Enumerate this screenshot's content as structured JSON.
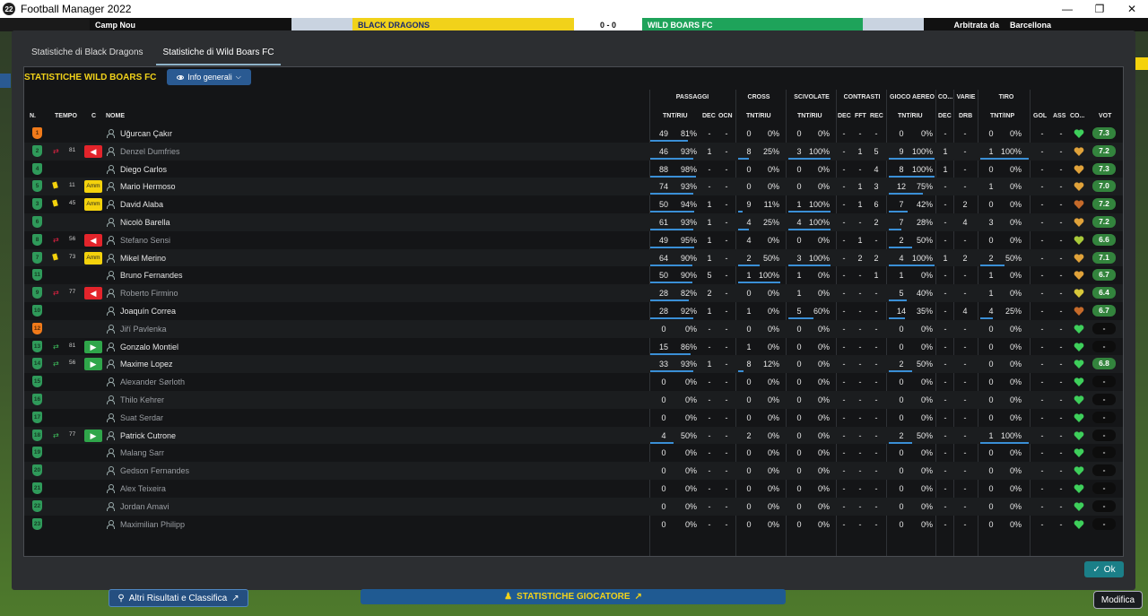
{
  "window": {
    "title": "Football Manager 2022",
    "app_icon": "22",
    "minimize": "—",
    "restore": "❐",
    "close": "✕"
  },
  "strip": {
    "stadium": "Camp Nou",
    "home_banner": "BLACK DRAGONS",
    "score": "0 - 0",
    "away_banner": "WILD BOARS FC",
    "referee_label": "Arbitrata da",
    "city": "Barcellona"
  },
  "tabs": [
    {
      "label": "Statistiche di Black Dragons",
      "active": false
    },
    {
      "label": "Statistiche di Wild Boars FC",
      "active": true
    }
  ],
  "panel": {
    "title": "STATISTICHE WILD BOARS FC",
    "filter_label": "Info generali",
    "filter_icon": "eye-icon",
    "chevron_icon": "chevron-down-icon"
  },
  "groups": {
    "passaggi": "PASSAGGI",
    "cross": "CROSS",
    "scivolate": "SCIVOLATE",
    "contrasti": "CONTRASTI",
    "gioco_aereo": "GIOCO AEREO",
    "co": "CO...",
    "varie": "VARIE",
    "tiro": "TIRO"
  },
  "columns": {
    "n": "N.",
    "tempo": "TEMPO",
    "c": "C",
    "nome": "NOME",
    "pass_tnt": "TNT/RIU",
    "pass_dec": "DEC",
    "pass_ocn": "OCN",
    "cross_tnt": "TNT/RIU",
    "sciv_tnt": "TNT/RIU",
    "con_dec": "DEC",
    "con_fft": "FFT",
    "con_rec": "REC",
    "aereo_tnt": "TNT/RIU",
    "co_dec": "DEC",
    "varie_drb": "DRB",
    "tiro_tnt": "TNT/INP",
    "gol": "GOL",
    "ass": "ASS",
    "co": "CO...",
    "vot": "VOT"
  },
  "colors": {
    "accent_yellow": "#f1d21a",
    "bar_blue": "#3a8fd6",
    "rating_green": "#33843d",
    "yellow_card": "#f4d20c",
    "sub_out": "#e3242b",
    "sub_in": "#2fa64a"
  },
  "players": [
    {
      "n": "1",
      "gk": true,
      "card": "",
      "sub": "",
      "min": "",
      "c": "",
      "name": "Uğurcan Çakır",
      "dim": false,
      "pass_t": "49",
      "pass_p": "81%",
      "pass_f": 0.81,
      "dec": "-",
      "ocn": "-",
      "cross_t": "0",
      "cross_p": "0%",
      "cross_f": 0,
      "sciv_t": "0",
      "sciv_p": "0%",
      "sciv_f": 0,
      "cdec": "-",
      "cfft": "-",
      "crec": "-",
      "aer_t": "0",
      "aer_p": "0%",
      "aer_f": 0,
      "codec": "-",
      "drb": "-",
      "tiro_t": "0",
      "tiro_p": "0%",
      "tiro_f": 0,
      "gol": "-",
      "ass": "-",
      "heart": "#3ecf5b",
      "vot": "7.3"
    },
    {
      "n": "2",
      "gk": false,
      "card": "",
      "sub": "out",
      "min": "81",
      "c": "out",
      "name": "Denzel Dumfries",
      "dim": true,
      "pass_t": "46",
      "pass_p": "93%",
      "pass_f": 0.93,
      "dec": "1",
      "ocn": "-",
      "cross_t": "8",
      "cross_p": "25%",
      "cross_f": 0.25,
      "sciv_t": "3",
      "sciv_p": "100%",
      "sciv_f": 1,
      "cdec": "-",
      "cfft": "1",
      "crec": "5",
      "aer_t": "9",
      "aer_p": "100%",
      "aer_f": 1,
      "codec": "1",
      "drb": "-",
      "tiro_t": "1",
      "tiro_p": "100%",
      "tiro_f": 1,
      "gol": "-",
      "ass": "-",
      "heart": "#e0a23a",
      "vot": "7.2"
    },
    {
      "n": "4",
      "gk": false,
      "card": "",
      "sub": "",
      "min": "",
      "c": "",
      "name": "Diego Carlos",
      "dim": false,
      "pass_t": "88",
      "pass_p": "98%",
      "pass_f": 0.98,
      "dec": "-",
      "ocn": "-",
      "cross_t": "0",
      "cross_p": "0%",
      "cross_f": 0,
      "sciv_t": "0",
      "sciv_p": "0%",
      "sciv_f": 0,
      "cdec": "-",
      "cfft": "-",
      "crec": "4",
      "aer_t": "8",
      "aer_p": "100%",
      "aer_f": 1,
      "codec": "1",
      "drb": "-",
      "tiro_t": "0",
      "tiro_p": "0%",
      "tiro_f": 0,
      "gol": "-",
      "ass": "-",
      "heart": "#e0a23a",
      "vot": "7.3"
    },
    {
      "n": "5",
      "gk": false,
      "card": "y",
      "sub": "",
      "min": "11",
      "c": "amm",
      "name": "Mario Hermoso",
      "dim": false,
      "pass_t": "74",
      "pass_p": "93%",
      "pass_f": 0.93,
      "dec": "-",
      "ocn": "-",
      "cross_t": "0",
      "cross_p": "0%",
      "cross_f": 0,
      "sciv_t": "0",
      "sciv_p": "0%",
      "sciv_f": 0,
      "cdec": "-",
      "cfft": "1",
      "crec": "3",
      "aer_t": "12",
      "aer_p": "75%",
      "aer_f": 0.75,
      "codec": "-",
      "drb": "-",
      "tiro_t": "1",
      "tiro_p": "0%",
      "tiro_f": 0,
      "gol": "-",
      "ass": "-",
      "heart": "#e0a23a",
      "vot": "7.0"
    },
    {
      "n": "3",
      "gk": false,
      "card": "y",
      "sub": "",
      "min": "45",
      "c": "amm",
      "name": "David Alaba",
      "dim": false,
      "pass_t": "50",
      "pass_p": "94%",
      "pass_f": 0.94,
      "dec": "1",
      "ocn": "-",
      "cross_t": "9",
      "cross_p": "11%",
      "cross_f": 0.11,
      "sciv_t": "1",
      "sciv_p": "100%",
      "sciv_f": 1,
      "cdec": "-",
      "cfft": "1",
      "crec": "6",
      "aer_t": "7",
      "aer_p": "42%",
      "aer_f": 0.42,
      "codec": "-",
      "drb": "2",
      "tiro_t": "0",
      "tiro_p": "0%",
      "tiro_f": 0,
      "gol": "-",
      "ass": "-",
      "heart": "#c56a2a",
      "vot": "7.2"
    },
    {
      "n": "6",
      "gk": false,
      "card": "",
      "sub": "",
      "min": "",
      "c": "",
      "name": "Nicolò Barella",
      "dim": false,
      "pass_t": "61",
      "pass_p": "93%",
      "pass_f": 0.93,
      "dec": "1",
      "ocn": "-",
      "cross_t": "4",
      "cross_p": "25%",
      "cross_f": 0.25,
      "sciv_t": "4",
      "sciv_p": "100%",
      "sciv_f": 1,
      "cdec": "-",
      "cfft": "-",
      "crec": "2",
      "aer_t": "7",
      "aer_p": "28%",
      "aer_f": 0.28,
      "codec": "-",
      "drb": "4",
      "tiro_t": "3",
      "tiro_p": "0%",
      "tiro_f": 0,
      "gol": "-",
      "ass": "-",
      "heart": "#e0a23a",
      "vot": "7.2"
    },
    {
      "n": "8",
      "gk": false,
      "card": "",
      "sub": "out",
      "min": "56",
      "c": "out",
      "name": "Stefano Sensi",
      "dim": true,
      "pass_t": "49",
      "pass_p": "95%",
      "pass_f": 0.95,
      "dec": "1",
      "ocn": "-",
      "cross_t": "4",
      "cross_p": "0%",
      "cross_f": 0,
      "sciv_t": "0",
      "sciv_p": "0%",
      "sciv_f": 0,
      "cdec": "-",
      "cfft": "1",
      "crec": "-",
      "aer_t": "2",
      "aer_p": "50%",
      "aer_f": 0.5,
      "codec": "-",
      "drb": "-",
      "tiro_t": "0",
      "tiro_p": "0%",
      "tiro_f": 0,
      "gol": "-",
      "ass": "-",
      "heart": "#a8c93a",
      "vot": "6.6"
    },
    {
      "n": "7",
      "gk": false,
      "card": "y",
      "sub": "",
      "min": "73",
      "c": "amm",
      "name": "Mikel Merino",
      "dim": false,
      "pass_t": "64",
      "pass_p": "90%",
      "pass_f": 0.9,
      "dec": "1",
      "ocn": "-",
      "cross_t": "2",
      "cross_p": "50%",
      "cross_f": 0.5,
      "sciv_t": "3",
      "sciv_p": "100%",
      "sciv_f": 1,
      "cdec": "-",
      "cfft": "2",
      "crec": "2",
      "aer_t": "4",
      "aer_p": "100%",
      "aer_f": 1,
      "codec": "1",
      "drb": "2",
      "tiro_t": "2",
      "tiro_p": "50%",
      "tiro_f": 0.5,
      "gol": "-",
      "ass": "-",
      "heart": "#e0a23a",
      "vot": "7.1"
    },
    {
      "n": "11",
      "gk": false,
      "card": "",
      "sub": "",
      "min": "",
      "c": "",
      "name": "Bruno Fernandes",
      "dim": false,
      "pass_t": "50",
      "pass_p": "90%",
      "pass_f": 0.9,
      "dec": "5",
      "ocn": "-",
      "cross_t": "1",
      "cross_p": "100%",
      "cross_f": 1,
      "sciv_t": "1",
      "sciv_p": "0%",
      "sciv_f": 0,
      "cdec": "-",
      "cfft": "-",
      "crec": "1",
      "aer_t": "1",
      "aer_p": "0%",
      "aer_f": 0,
      "codec": "-",
      "drb": "-",
      "tiro_t": "1",
      "tiro_p": "0%",
      "tiro_f": 0,
      "gol": "-",
      "ass": "-",
      "heart": "#e0a23a",
      "vot": "6.7"
    },
    {
      "n": "9",
      "gk": false,
      "card": "",
      "sub": "out",
      "min": "77",
      "c": "out",
      "name": "Roberto Firmino",
      "dim": true,
      "pass_t": "28",
      "pass_p": "82%",
      "pass_f": 0.82,
      "dec": "2",
      "ocn": "-",
      "cross_t": "0",
      "cross_p": "0%",
      "cross_f": 0,
      "sciv_t": "1",
      "sciv_p": "0%",
      "sciv_f": 0,
      "cdec": "-",
      "cfft": "-",
      "crec": "-",
      "aer_t": "5",
      "aer_p": "40%",
      "aer_f": 0.4,
      "codec": "-",
      "drb": "-",
      "tiro_t": "1",
      "tiro_p": "0%",
      "tiro_f": 0,
      "gol": "-",
      "ass": "-",
      "heart": "#d8c83a",
      "vot": "6.4"
    },
    {
      "n": "10",
      "gk": false,
      "card": "",
      "sub": "",
      "min": "",
      "c": "",
      "name": "Joaquín Correa",
      "dim": false,
      "pass_t": "28",
      "pass_p": "92%",
      "pass_f": 0.92,
      "dec": "1",
      "ocn": "-",
      "cross_t": "1",
      "cross_p": "0%",
      "cross_f": 0,
      "sciv_t": "5",
      "sciv_p": "60%",
      "sciv_f": 0.6,
      "cdec": "-",
      "cfft": "-",
      "crec": "-",
      "aer_t": "14",
      "aer_p": "35%",
      "aer_f": 0.35,
      "codec": "-",
      "drb": "4",
      "tiro_t": "4",
      "tiro_p": "25%",
      "tiro_f": 0.25,
      "gol": "-",
      "ass": "-",
      "heart": "#c56a2a",
      "vot": "6.7"
    },
    {
      "n": "12",
      "gk": true,
      "card": "",
      "sub": "",
      "min": "",
      "c": "",
      "name": "Jiří Pavlenka",
      "dim": true,
      "pass_t": "0",
      "pass_p": "0%",
      "pass_f": 0,
      "dec": "-",
      "ocn": "-",
      "cross_t": "0",
      "cross_p": "0%",
      "cross_f": 0,
      "sciv_t": "0",
      "sciv_p": "0%",
      "sciv_f": 0,
      "cdec": "-",
      "cfft": "-",
      "crec": "-",
      "aer_t": "0",
      "aer_p": "0%",
      "aer_f": 0,
      "codec": "-",
      "drb": "-",
      "tiro_t": "0",
      "tiro_p": "0%",
      "tiro_f": 0,
      "gol": "-",
      "ass": "-",
      "heart": "#3ecf5b",
      "vot": "-"
    },
    {
      "n": "13",
      "gk": false,
      "card": "",
      "sub": "in",
      "min": "81",
      "c": "in",
      "name": "Gonzalo Montiel",
      "dim": false,
      "pass_t": "15",
      "pass_p": "86%",
      "pass_f": 0.86,
      "dec": "-",
      "ocn": "-",
      "cross_t": "1",
      "cross_p": "0%",
      "cross_f": 0,
      "sciv_t": "0",
      "sciv_p": "0%",
      "sciv_f": 0,
      "cdec": "-",
      "cfft": "-",
      "crec": "-",
      "aer_t": "0",
      "aer_p": "0%",
      "aer_f": 0,
      "codec": "-",
      "drb": "-",
      "tiro_t": "0",
      "tiro_p": "0%",
      "tiro_f": 0,
      "gol": "-",
      "ass": "-",
      "heart": "#3ecf5b",
      "vot": "-"
    },
    {
      "n": "14",
      "gk": false,
      "card": "",
      "sub": "in",
      "min": "56",
      "c": "in",
      "name": "Maxime Lopez",
      "dim": false,
      "pass_t": "33",
      "pass_p": "93%",
      "pass_f": 0.93,
      "dec": "1",
      "ocn": "-",
      "cross_t": "8",
      "cross_p": "12%",
      "cross_f": 0.12,
      "sciv_t": "0",
      "sciv_p": "0%",
      "sciv_f": 0,
      "cdec": "-",
      "cfft": "-",
      "crec": "-",
      "aer_t": "2",
      "aer_p": "50%",
      "aer_f": 0.5,
      "codec": "-",
      "drb": "-",
      "tiro_t": "0",
      "tiro_p": "0%",
      "tiro_f": 0,
      "gol": "-",
      "ass": "-",
      "heart": "#3ecf5b",
      "vot": "6.8"
    },
    {
      "n": "15",
      "gk": false,
      "card": "",
      "sub": "",
      "min": "",
      "c": "",
      "name": "Alexander Sørloth",
      "dim": true,
      "pass_t": "0",
      "pass_p": "0%",
      "pass_f": 0,
      "dec": "-",
      "ocn": "-",
      "cross_t": "0",
      "cross_p": "0%",
      "cross_f": 0,
      "sciv_t": "0",
      "sciv_p": "0%",
      "sciv_f": 0,
      "cdec": "-",
      "cfft": "-",
      "crec": "-",
      "aer_t": "0",
      "aer_p": "0%",
      "aer_f": 0,
      "codec": "-",
      "drb": "-",
      "tiro_t": "0",
      "tiro_p": "0%",
      "tiro_f": 0,
      "gol": "-",
      "ass": "-",
      "heart": "#3ecf5b",
      "vot": "-"
    },
    {
      "n": "16",
      "gk": false,
      "card": "",
      "sub": "",
      "min": "",
      "c": "",
      "name": "Thilo Kehrer",
      "dim": true,
      "pass_t": "0",
      "pass_p": "0%",
      "pass_f": 0,
      "dec": "-",
      "ocn": "-",
      "cross_t": "0",
      "cross_p": "0%",
      "cross_f": 0,
      "sciv_t": "0",
      "sciv_p": "0%",
      "sciv_f": 0,
      "cdec": "-",
      "cfft": "-",
      "crec": "-",
      "aer_t": "0",
      "aer_p": "0%",
      "aer_f": 0,
      "codec": "-",
      "drb": "-",
      "tiro_t": "0",
      "tiro_p": "0%",
      "tiro_f": 0,
      "gol": "-",
      "ass": "-",
      "heart": "#3ecf5b",
      "vot": "-"
    },
    {
      "n": "17",
      "gk": false,
      "card": "",
      "sub": "",
      "min": "",
      "c": "",
      "name": "Suat Serdar",
      "dim": true,
      "pass_t": "0",
      "pass_p": "0%",
      "pass_f": 0,
      "dec": "-",
      "ocn": "-",
      "cross_t": "0",
      "cross_p": "0%",
      "cross_f": 0,
      "sciv_t": "0",
      "sciv_p": "0%",
      "sciv_f": 0,
      "cdec": "-",
      "cfft": "-",
      "crec": "-",
      "aer_t": "0",
      "aer_p": "0%",
      "aer_f": 0,
      "codec": "-",
      "drb": "-",
      "tiro_t": "0",
      "tiro_p": "0%",
      "tiro_f": 0,
      "gol": "-",
      "ass": "-",
      "heart": "#3ecf5b",
      "vot": "-"
    },
    {
      "n": "18",
      "gk": false,
      "card": "",
      "sub": "in",
      "min": "77",
      "c": "in",
      "name": "Patrick Cutrone",
      "dim": false,
      "pass_t": "4",
      "pass_p": "50%",
      "pass_f": 0.5,
      "dec": "-",
      "ocn": "-",
      "cross_t": "2",
      "cross_p": "0%",
      "cross_f": 0,
      "sciv_t": "0",
      "sciv_p": "0%",
      "sciv_f": 0,
      "cdec": "-",
      "cfft": "-",
      "crec": "-",
      "aer_t": "2",
      "aer_p": "50%",
      "aer_f": 0.5,
      "codec": "-",
      "drb": "-",
      "tiro_t": "1",
      "tiro_p": "100%",
      "tiro_f": 1,
      "gol": "-",
      "ass": "-",
      "heart": "#3ecf5b",
      "vot": "-"
    },
    {
      "n": "19",
      "gk": false,
      "card": "",
      "sub": "",
      "min": "",
      "c": "",
      "name": "Malang Sarr",
      "dim": true,
      "pass_t": "0",
      "pass_p": "0%",
      "pass_f": 0,
      "dec": "-",
      "ocn": "-",
      "cross_t": "0",
      "cross_p": "0%",
      "cross_f": 0,
      "sciv_t": "0",
      "sciv_p": "0%",
      "sciv_f": 0,
      "cdec": "-",
      "cfft": "-",
      "crec": "-",
      "aer_t": "0",
      "aer_p": "0%",
      "aer_f": 0,
      "codec": "-",
      "drb": "-",
      "tiro_t": "0",
      "tiro_p": "0%",
      "tiro_f": 0,
      "gol": "-",
      "ass": "-",
      "heart": "#3ecf5b",
      "vot": "-"
    },
    {
      "n": "20",
      "gk": false,
      "card": "",
      "sub": "",
      "min": "",
      "c": "",
      "name": "Gedson Fernandes",
      "dim": true,
      "pass_t": "0",
      "pass_p": "0%",
      "pass_f": 0,
      "dec": "-",
      "ocn": "-",
      "cross_t": "0",
      "cross_p": "0%",
      "cross_f": 0,
      "sciv_t": "0",
      "sciv_p": "0%",
      "sciv_f": 0,
      "cdec": "-",
      "cfft": "-",
      "crec": "-",
      "aer_t": "0",
      "aer_p": "0%",
      "aer_f": 0,
      "codec": "-",
      "drb": "-",
      "tiro_t": "0",
      "tiro_p": "0%",
      "tiro_f": 0,
      "gol": "-",
      "ass": "-",
      "heart": "#3ecf5b",
      "vot": "-"
    },
    {
      "n": "21",
      "gk": false,
      "card": "",
      "sub": "",
      "min": "",
      "c": "",
      "name": "Alex Teixeira",
      "dim": true,
      "pass_t": "0",
      "pass_p": "0%",
      "pass_f": 0,
      "dec": "-",
      "ocn": "-",
      "cross_t": "0",
      "cross_p": "0%",
      "cross_f": 0,
      "sciv_t": "0",
      "sciv_p": "0%",
      "sciv_f": 0,
      "cdec": "-",
      "cfft": "-",
      "crec": "-",
      "aer_t": "0",
      "aer_p": "0%",
      "aer_f": 0,
      "codec": "-",
      "drb": "-",
      "tiro_t": "0",
      "tiro_p": "0%",
      "tiro_f": 0,
      "gol": "-",
      "ass": "-",
      "heart": "#3ecf5b",
      "vot": "-"
    },
    {
      "n": "22",
      "gk": false,
      "card": "",
      "sub": "",
      "min": "",
      "c": "",
      "name": "Jordan Amavi",
      "dim": true,
      "pass_t": "0",
      "pass_p": "0%",
      "pass_f": 0,
      "dec": "-",
      "ocn": "-",
      "cross_t": "0",
      "cross_p": "0%",
      "cross_f": 0,
      "sciv_t": "0",
      "sciv_p": "0%",
      "sciv_f": 0,
      "cdec": "-",
      "cfft": "-",
      "crec": "-",
      "aer_t": "0",
      "aer_p": "0%",
      "aer_f": 0,
      "codec": "-",
      "drb": "-",
      "tiro_t": "0",
      "tiro_p": "0%",
      "tiro_f": 0,
      "gol": "-",
      "ass": "-",
      "heart": "#3ecf5b",
      "vot": "-"
    },
    {
      "n": "23",
      "gk": false,
      "card": "",
      "sub": "",
      "min": "",
      "c": "",
      "name": "Maximilian Philipp",
      "dim": true,
      "pass_t": "0",
      "pass_p": "0%",
      "pass_f": 0,
      "dec": "-",
      "ocn": "-",
      "cross_t": "0",
      "cross_p": "0%",
      "cross_f": 0,
      "sciv_t": "0",
      "sciv_p": "0%",
      "sciv_f": 0,
      "cdec": "-",
      "cfft": "-",
      "crec": "-",
      "aer_t": "0",
      "aer_p": "0%",
      "aer_f": 0,
      "codec": "-",
      "drb": "-",
      "tiro_t": "0",
      "tiro_p": "0%",
      "tiro_f": 0,
      "gol": "-",
      "ass": "-",
      "heart": "#3ecf5b",
      "vot": "-"
    }
  ],
  "badges": {
    "amm": "Amm"
  },
  "footer": {
    "ok_label": "Ok",
    "ok_icon": "check-icon",
    "results_label": "Altri Risultati e Classifica",
    "results_icon": "trophy-icon",
    "player_stats_label": "STATISTICHE GIOCATORE",
    "player_stats_icon": "person-icon",
    "external_icon": "external-link-icon",
    "modifica_label": "Modifica"
  }
}
